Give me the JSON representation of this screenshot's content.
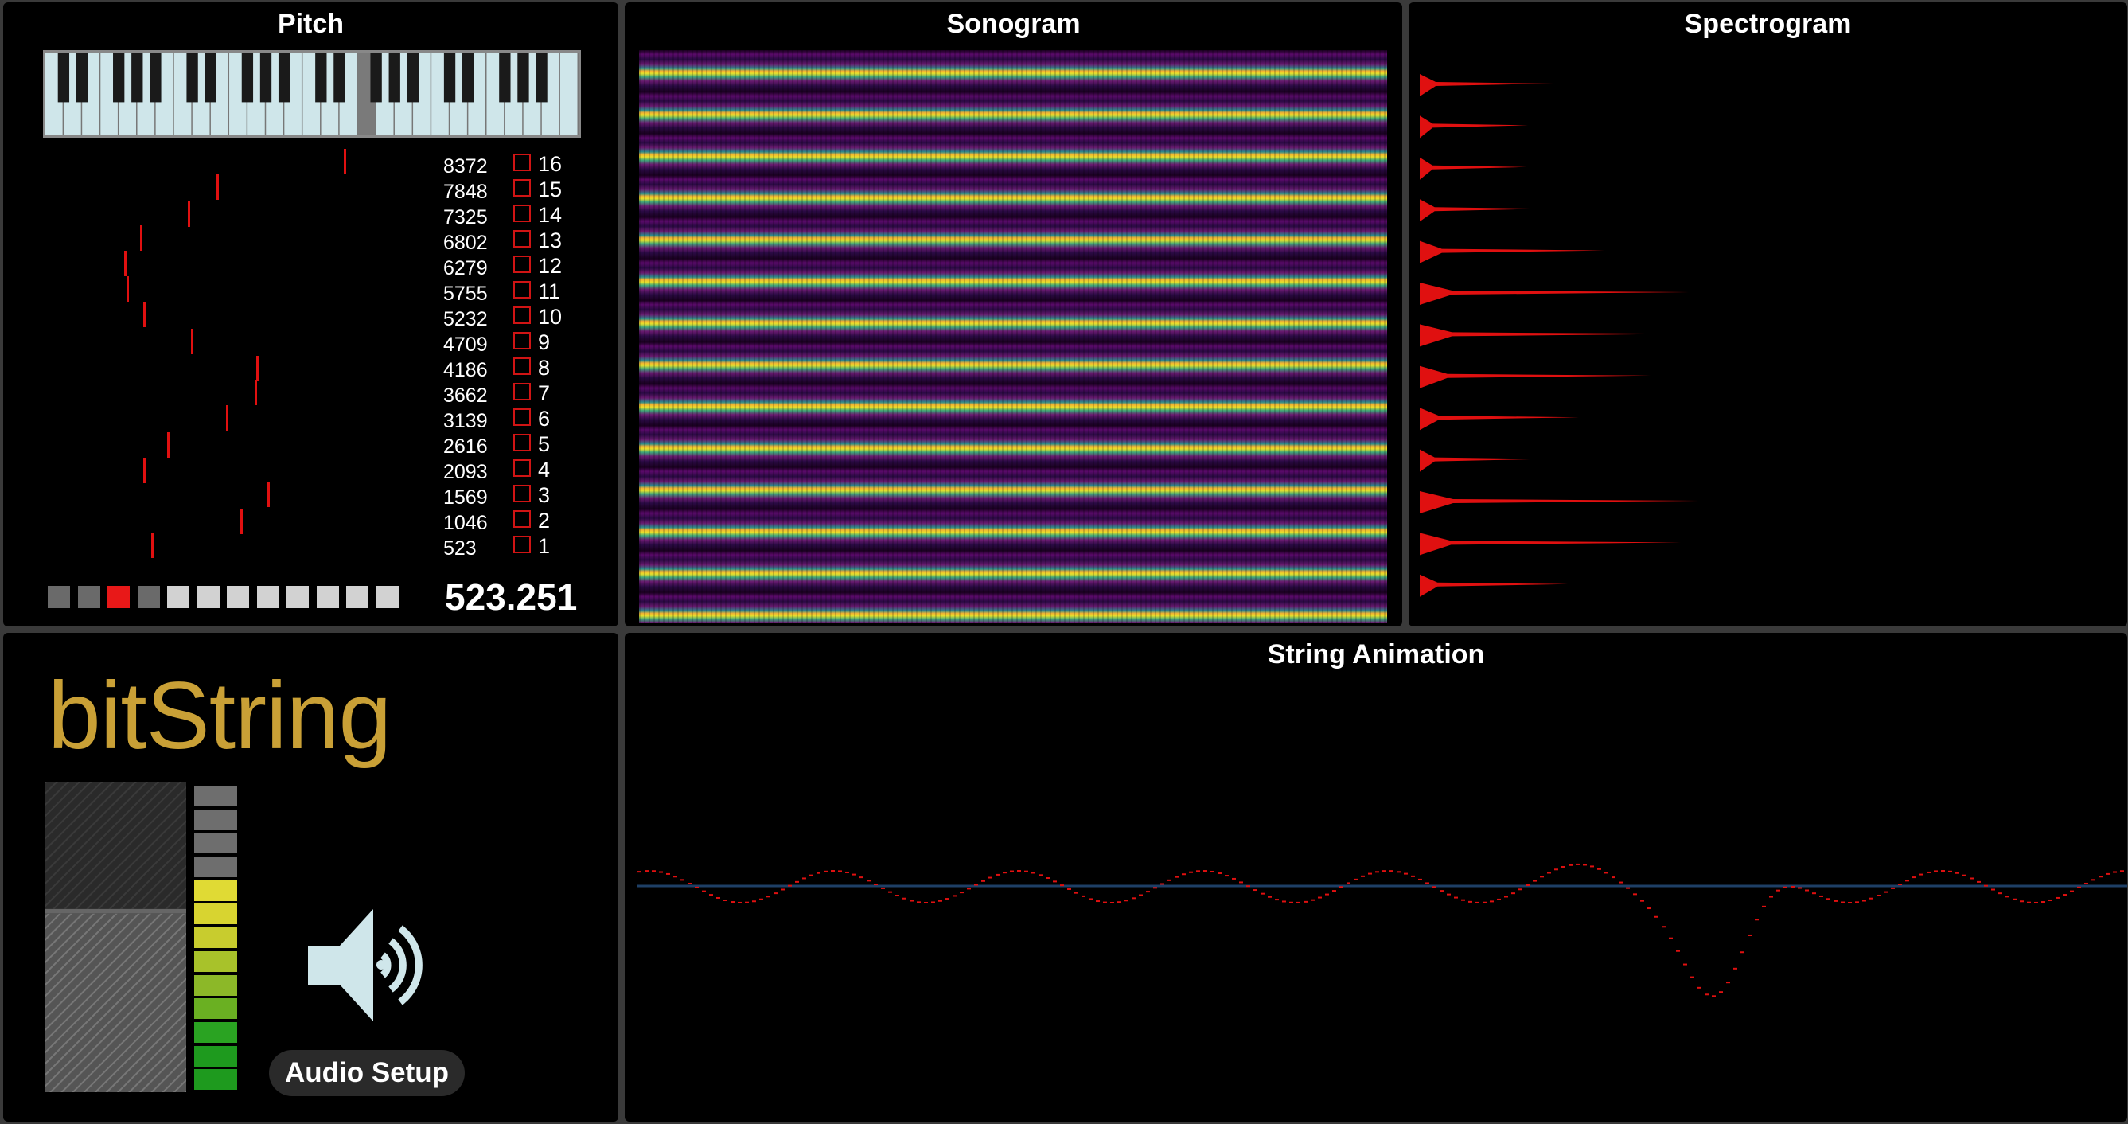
{
  "panels": {
    "pitch_title": "Pitch",
    "sonogram_title": "Sonogram",
    "spectrogram_title": "Spectrogram",
    "string_title": "String Animation"
  },
  "pitch": {
    "frequencies": [
      "8372",
      "7848",
      "7325",
      "6802",
      "6279",
      "5755",
      "5232",
      "4709",
      "4186",
      "3662",
      "3139",
      "2616",
      "2093",
      "1569",
      "1046",
      "523"
    ],
    "harmonics": [
      "16",
      "15",
      "14",
      "13",
      "12",
      "11",
      "10",
      "9",
      "8",
      "7",
      "6",
      "5",
      "4",
      "3",
      "2",
      "1"
    ],
    "readout": "523.251",
    "sequence_cells": [
      {
        "state": "past",
        "color": "#6a6a6a"
      },
      {
        "state": "past",
        "color": "#6a6a6a"
      },
      {
        "state": "active",
        "color": "#e81818"
      },
      {
        "state": "past",
        "color": "#6a6a6a"
      },
      {
        "state": "future",
        "color": "#d2d2d2"
      },
      {
        "state": "future",
        "color": "#d2d2d2"
      },
      {
        "state": "future",
        "color": "#d2d2d2"
      },
      {
        "state": "future",
        "color": "#d2d2d2"
      },
      {
        "state": "future",
        "color": "#d2d2d2"
      },
      {
        "state": "future",
        "color": "#d2d2d2"
      },
      {
        "state": "future",
        "color": "#d2d2d2"
      },
      {
        "state": "future",
        "color": "#d2d2d2"
      }
    ]
  },
  "bitstring": {
    "logo": "bitString",
    "audio_setup_label": "Audio Setup",
    "volume_level": 0.58,
    "meter_lit_segments": 9,
    "meter_total_segments": 13,
    "speaker_icon": "speaker-icon"
  },
  "colors": {
    "accent_red": "#e01010",
    "logo_gold": "#c9a036",
    "baseline_blue": "#1e3f66"
  }
}
